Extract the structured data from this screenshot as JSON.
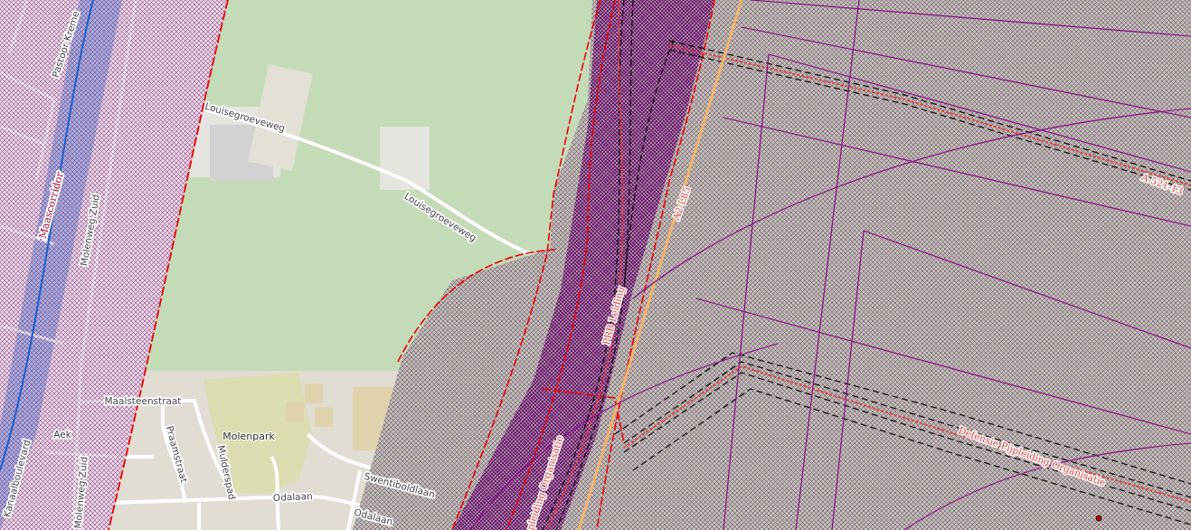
{
  "map": {
    "labels": [
      {
        "text": "Pastoor Kreme",
        "kind": "street"
      },
      {
        "text": "Maascorridor",
        "kind": "corridor"
      },
      {
        "text": "Molenweg Zuid",
        "kind": "street"
      },
      {
        "text": "Louisegroeveweg",
        "kind": "street"
      },
      {
        "text": "Louisegroeveweg",
        "kind": "street"
      },
      {
        "text": "Maalsteenstraat",
        "kind": "street"
      },
      {
        "text": "Aek",
        "kind": "street"
      },
      {
        "text": "Kanaalboulevard",
        "kind": "street"
      },
      {
        "text": "Molenweg Zuid",
        "kind": "street"
      },
      {
        "text": "Praamstraat",
        "kind": "street"
      },
      {
        "text": "Mulderspad",
        "kind": "street"
      },
      {
        "text": "Molenpark",
        "kind": "place"
      },
      {
        "text": "Odalaan",
        "kind": "street"
      },
      {
        "text": "Swentiboldlaan",
        "kind": "street"
      },
      {
        "text": "Odalaan",
        "kind": "street"
      },
      {
        "text": "PRB Leiding",
        "kind": "pipeline"
      },
      {
        "text": "A2-L85",
        "kind": "pipeline"
      },
      {
        "text": "A-521-13",
        "kind": "pipeline"
      },
      {
        "text": "Defensie Pijpleiding Organisatie",
        "kind": "pipeline"
      },
      {
        "text": "pleiding Organisatie",
        "kind": "pipeline"
      }
    ]
  }
}
